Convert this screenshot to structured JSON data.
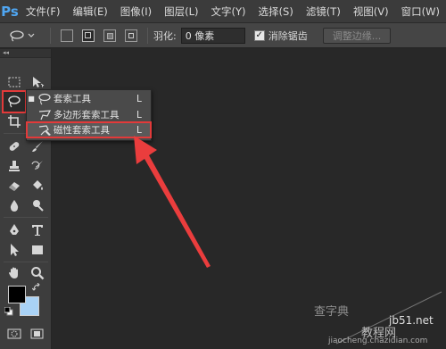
{
  "menubar": {
    "logo": "Ps",
    "items": [
      "文件(F)",
      "编辑(E)",
      "图像(I)",
      "图层(L)",
      "文字(Y)",
      "选择(S)",
      "滤镜(T)",
      "视图(V)",
      "窗口(W)"
    ]
  },
  "options": {
    "feather_label": "羽化:",
    "feather_value": "0 像素",
    "antialias_label": "消除锯齿",
    "antialias_checked": true,
    "refine_edge_label": "调整边缘..."
  },
  "toolbar": {
    "collapse": "◂◂",
    "foreground_color": "#000000",
    "background_color": "#a9d2f5"
  },
  "flyout": {
    "items": [
      {
        "label": "套索工具",
        "shortcut": "L",
        "current": true
      },
      {
        "label": "多边形套索工具",
        "shortcut": "L",
        "current": false
      },
      {
        "label": "磁性套索工具",
        "shortcut": "L",
        "current": false,
        "highlighted": true
      }
    ]
  },
  "watermark": {
    "site": "jb51.net",
    "line1": "查字典",
    "line2": "教程网",
    "url": "jiaocheng.chazidian.com"
  },
  "colors": {
    "highlight_border": "#e23a3a",
    "logo": "#4fa6f2"
  }
}
